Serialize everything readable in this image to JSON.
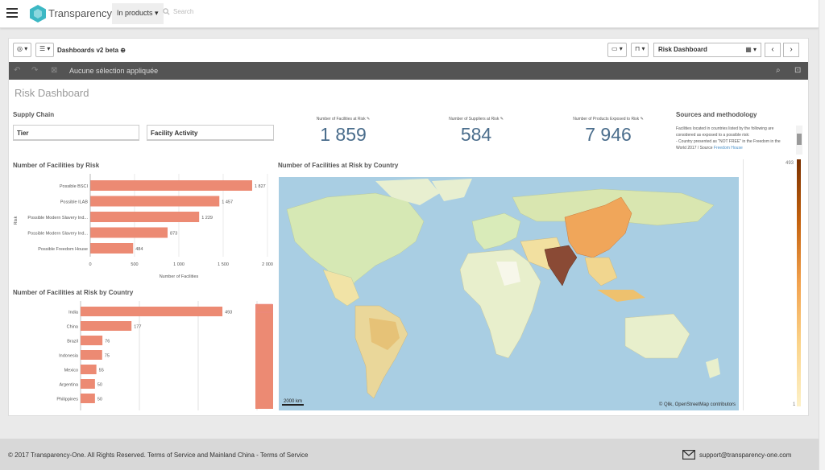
{
  "header": {
    "logo_text": "Transparency-One",
    "products_dropdown": "In products",
    "search_placeholder": "Search"
  },
  "toolbar": {
    "app_title": "Dashboards v2 beta",
    "sheet_name": "Risk Dashboard"
  },
  "selection_bar": {
    "text": "Aucune sélection appliquée"
  },
  "sheet": {
    "title": "Risk Dashboard",
    "supply_chain_label": "Supply Chain",
    "filters": [
      "Tier",
      "Facility Activity"
    ],
    "kpis": [
      {
        "label": "Number of Facilities at Risk",
        "value": "1 859"
      },
      {
        "label": "Number of Suppliers at Risk",
        "value": "584"
      },
      {
        "label": "Number of Products Exposed to Risk",
        "value": "7 946"
      }
    ],
    "sources": {
      "title": "Sources and methodology",
      "text_1": "Facilities located in countries listed by the following are considered as exposed to a possible risk:",
      "text_2": "- Country presented as \"NOT FREE\" in the Freedom in the World 2017 / Source",
      "link": "Freedom House"
    }
  },
  "chart_data": [
    {
      "type": "bar",
      "title": "Number of Facilities by Risk",
      "xlabel": "Number of Facilities",
      "ylabel": "Risk",
      "categories": [
        "Possible BSCI",
        "Possible ILAB",
        "Possible Modern Slavery Ind...",
        "Possible Modern Slavery Ind...",
        "Possible Freedom House"
      ],
      "values": [
        1827,
        1457,
        1229,
        873,
        484
      ],
      "value_labels": [
        "1 827",
        "1 457",
        "1 229",
        "873",
        "484"
      ],
      "xlim": [
        0,
        2000
      ],
      "ticks": [
        "0",
        "500",
        "1 000",
        "1 500",
        "2 000"
      ]
    },
    {
      "type": "bar",
      "title": "Number of Facilities at Risk by Country",
      "categories": [
        "India",
        "China",
        "Brazil",
        "Indonesia",
        "Mexico",
        "Argentina",
        "Philippines"
      ],
      "values": [
        493,
        177,
        76,
        75,
        55,
        50,
        50
      ]
    }
  ],
  "map": {
    "title": "Number of Facilities at Risk by Country",
    "scale": "2000 km",
    "attribution": "© Qlik, OpenStreetMap contributors",
    "legend_max": "493",
    "legend_min": "1"
  },
  "footer": {
    "copyright": "© 2017 Transparency-One. All Rights Reserved. Terms of Service and Mainland China - Terms of Service",
    "email": "support@transparency-one.com"
  }
}
